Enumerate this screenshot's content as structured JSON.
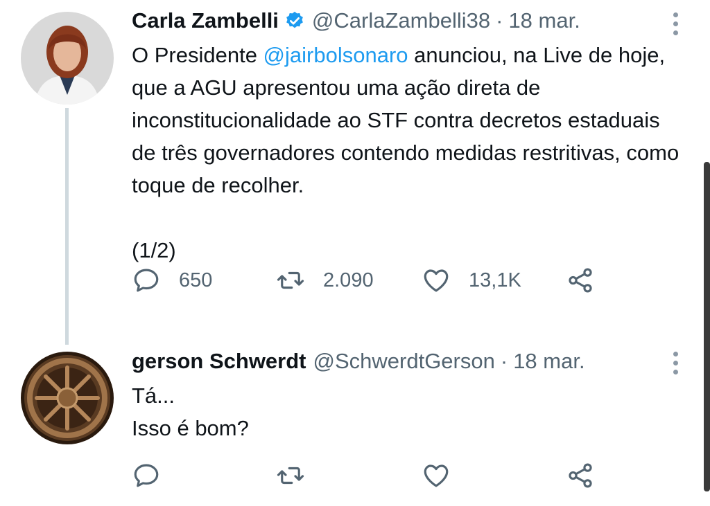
{
  "colors": {
    "accent": "#1d9bf0",
    "text": "#0f1419",
    "muted": "#536471",
    "thread_line": "#cfd9de"
  },
  "tweets": [
    {
      "author_name": "Carla Zambelli",
      "verified": true,
      "handle": "@CarlaZambelli38",
      "separator": "·",
      "date": "18 mar.",
      "text_before_mention": "O Presidente ",
      "mention": "@jairbolsonaro",
      "text_after_mention": " anunciou, na Live de hoje, que a AGU apresentou uma ação direta de inconstitucionalidade ao STF contra decretos estaduais de três governadores contendo medidas restritivas, como toque de recolher.",
      "text_footer": "(1/2)",
      "replies": "650",
      "retweets": "2.090",
      "likes": "13,1K",
      "icons": [
        "reply-icon",
        "retweet-icon",
        "like-icon",
        "share-icon"
      ]
    },
    {
      "author_name": "gerson Schwerdt",
      "verified": false,
      "handle": "@SchwerdtGerson",
      "separator": "·",
      "date": "18 mar.",
      "text_line_1": "Tá...",
      "text_line_2": "Isso é bom?",
      "icons": [
        "reply-icon",
        "retweet-icon",
        "like-icon",
        "share-icon"
      ]
    }
  ]
}
